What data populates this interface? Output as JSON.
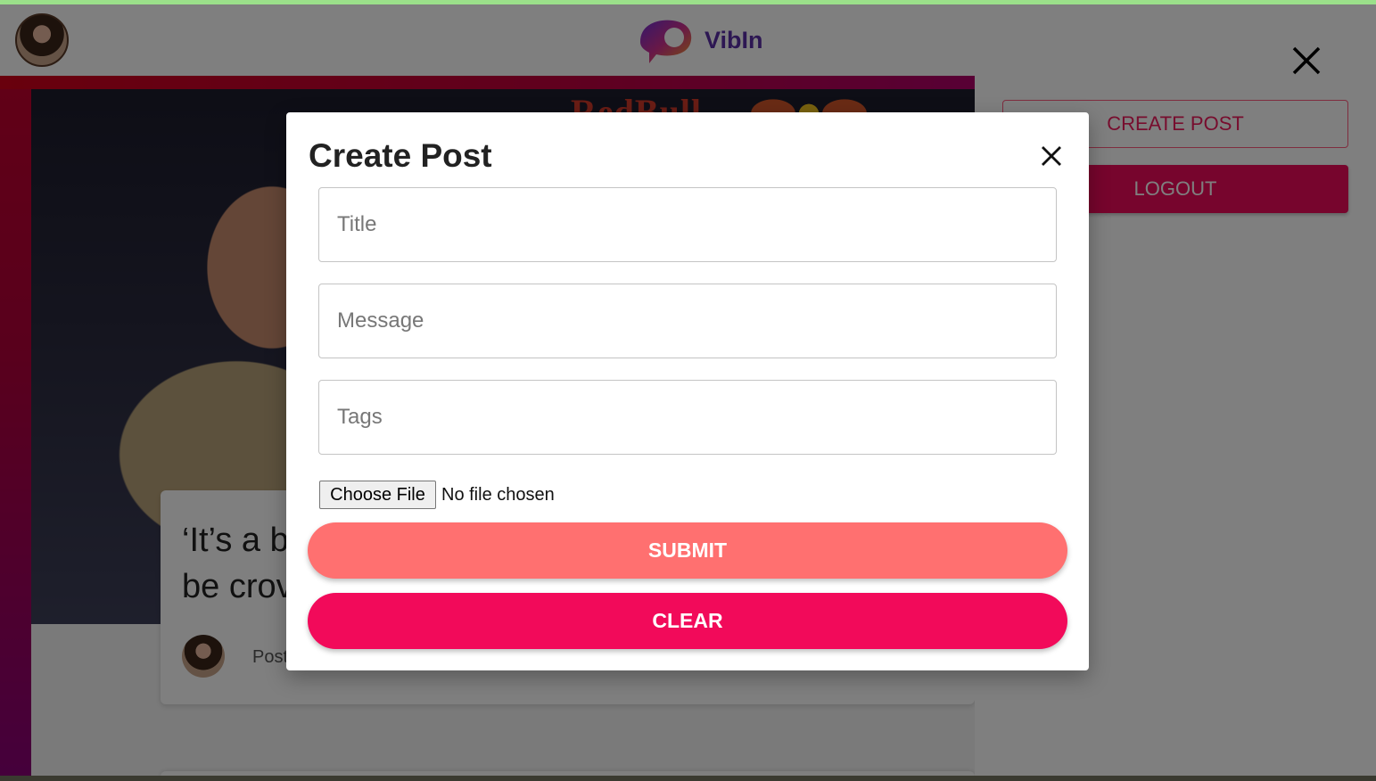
{
  "app": {
    "brand_name": "VibIn"
  },
  "post_card": {
    "title": "‘It’s a b be crov",
    "meta": "Post",
    "image_text": "RedBull"
  },
  "drawer": {
    "create_post_label": "CREATE POST",
    "logout_label": "LOGOUT"
  },
  "modal": {
    "title": "Create Post",
    "fields": {
      "title_placeholder": "Title",
      "message_placeholder": "Message",
      "tags_placeholder": "Tags"
    },
    "file": {
      "button_label": "Choose File",
      "status": "No file chosen"
    },
    "submit_label": "SUBMIT",
    "clear_label": "CLEAR"
  },
  "colors": {
    "accent_pink": "#f20a5a",
    "submit_salmon": "#ff7070",
    "brand_purple": "#5a2ea6"
  }
}
